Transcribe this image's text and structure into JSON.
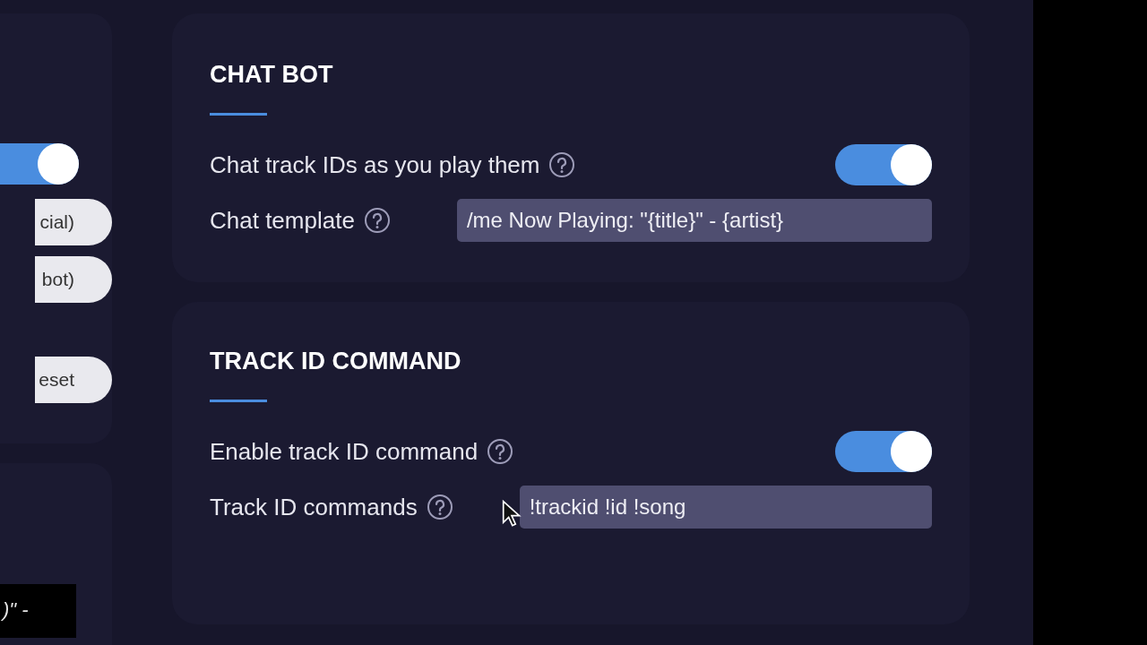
{
  "left_panel": {
    "toggle": {
      "on": true
    },
    "buttons": [
      "cial)",
      "bot)",
      "eset"
    ]
  },
  "caption": ")\" -",
  "sections": [
    {
      "title": "CHAT BOT",
      "rows": [
        {
          "kind": "toggle",
          "label": "Chat track IDs as you play them",
          "on": true
        },
        {
          "kind": "input",
          "label": "Chat template",
          "value": "/me Now Playing: \"{title}\" - {artist}"
        }
      ]
    },
    {
      "title": "TRACK ID COMMAND",
      "rows": [
        {
          "kind": "toggle",
          "label": "Enable track ID command",
          "on": true
        },
        {
          "kind": "input",
          "label": "Track ID commands",
          "value": "!trackid !id !song"
        }
      ]
    }
  ]
}
